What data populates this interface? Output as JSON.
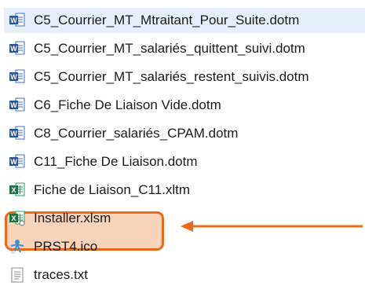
{
  "files": [
    {
      "name": "C5_Courrier_MT_Mtraitant_Pour_Suite.dotm",
      "icon": "word-template-icon",
      "selected": true
    },
    {
      "name": "C5_Courrier_MT_salariés_quittent_suivi.dotm",
      "icon": "word-template-icon"
    },
    {
      "name": "C5_Courrier_MT_salariés_restent_suivis.dotm",
      "icon": "word-template-icon"
    },
    {
      "name": "C6_Fiche De Liaison Vide.dotm",
      "icon": "word-template-icon"
    },
    {
      "name": "C8_Courrier_salariés_CPAM.dotm",
      "icon": "word-template-icon"
    },
    {
      "name": "C11_Fiche De Liaison.dotm",
      "icon": "word-template-icon"
    },
    {
      "name": "Fiche de Liaison_C11.xltm",
      "icon": "excel-template-icon"
    },
    {
      "name": "Installer.xlsm",
      "icon": "excel-macro-icon",
      "highlighted": true
    },
    {
      "name": "PRST4.ico",
      "icon": "ico-file-icon"
    },
    {
      "name": "traces.txt",
      "icon": "text-file-icon"
    }
  ],
  "colors": {
    "selection": "#e5f0fb",
    "highlight_border": "#e86a1a",
    "highlight_fill": "#f4b183",
    "arrow": "#e86a1a",
    "word_blue": "#2b579a",
    "excel_green": "#217346"
  }
}
